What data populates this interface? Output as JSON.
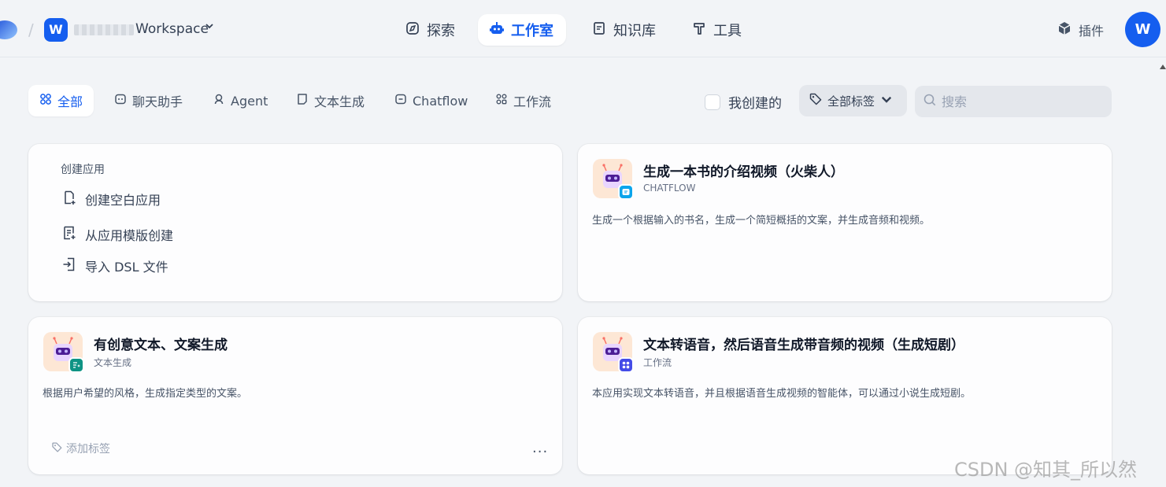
{
  "header": {
    "workspace_initial": "W",
    "workspace_name": "Workspace",
    "nav": [
      {
        "label": "探索",
        "icon": "compass-icon"
      },
      {
        "label": "工作室",
        "icon": "robot-icon",
        "active": true
      },
      {
        "label": "知识库",
        "icon": "book-icon"
      },
      {
        "label": "工具",
        "icon": "hammer-icon"
      }
    ],
    "plugin_label": "插件",
    "avatar_initial": "W"
  },
  "filters": {
    "tabs": [
      {
        "label": "全部",
        "active": true
      },
      {
        "label": "聊天助手"
      },
      {
        "label": "Agent"
      },
      {
        "label": "文本生成"
      },
      {
        "label": "Chatflow"
      },
      {
        "label": "工作流"
      }
    ],
    "mine_label": "我创建的",
    "tags_label": "全部标签",
    "search_placeholder": "搜索"
  },
  "create_card": {
    "title": "创建应用",
    "options": [
      "创建空白应用",
      "从应用模版创建",
      "导入 DSL 文件"
    ]
  },
  "apps": [
    {
      "title": "生成一本书的介绍视频（火柴人）",
      "type": "CHATFLOW",
      "description": "生成一个根据输入的书名，生成一个简短概括的文案，并生成音频和视频。",
      "badge_color": "#0ba5ec",
      "badge_icon": "chat-bubble-icon"
    },
    {
      "title": "有创意文本、文案生成",
      "type": "文本生成",
      "description": "根据用户希望的风格，生成指定类型的文案。",
      "badge_color": "#0e9384",
      "badge_icon": "text-sparkle-icon",
      "tag_label": "添加标签",
      "more_label": "..."
    },
    {
      "title": "文本转语音，然后语音生成带音频的视频（生成短剧）",
      "type": "工作流",
      "description": "本应用实现文本转语音，并且根据语音生成视频的智能体，可以通过小说生成短剧。",
      "badge_color": "#444ce7",
      "badge_icon": "workflow-icon"
    }
  ],
  "watermark": "CSDN @知其_所以然"
}
